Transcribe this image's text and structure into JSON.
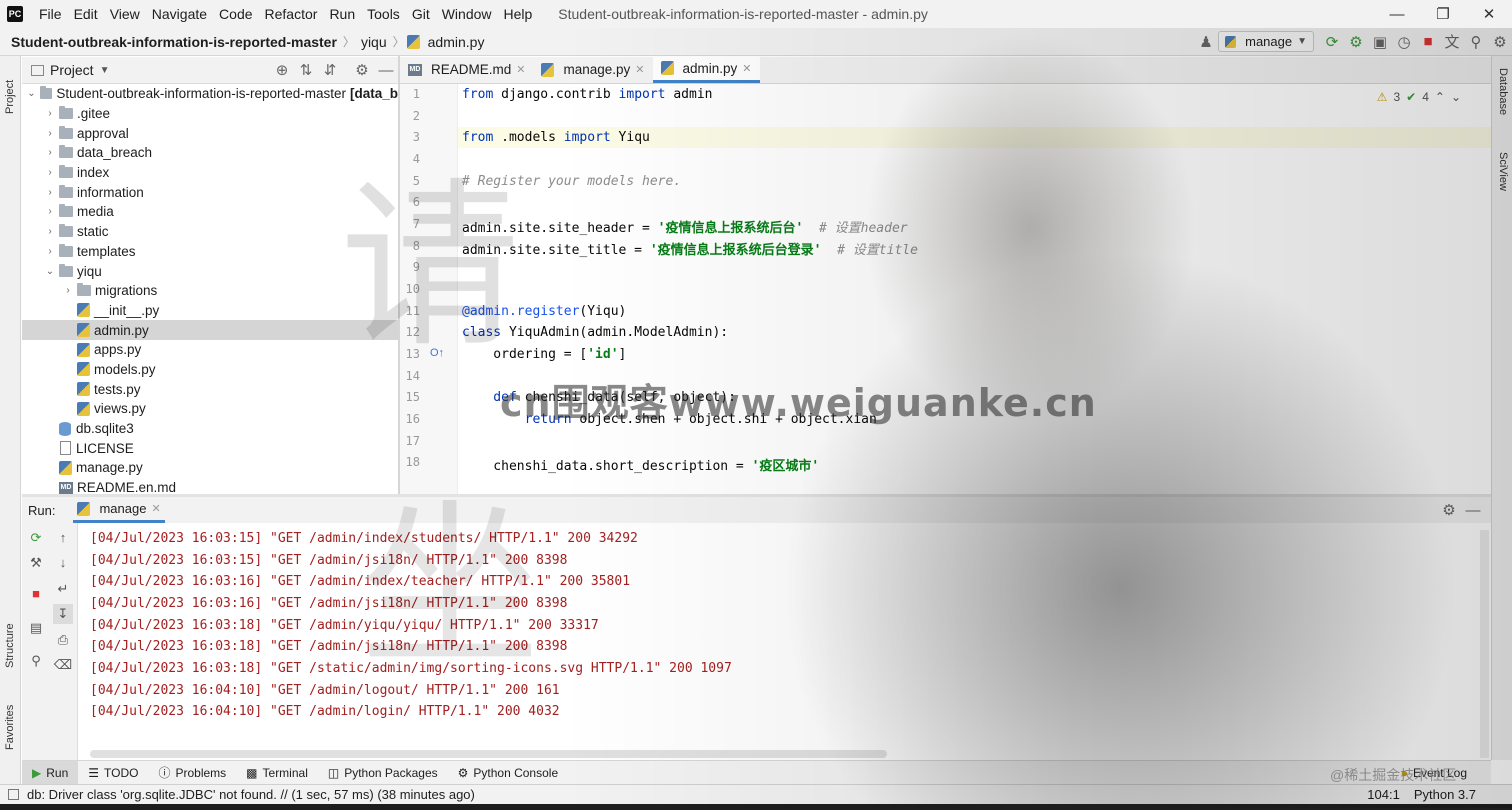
{
  "menubar": {
    "items": [
      "File",
      "Edit",
      "View",
      "Navigate",
      "Code",
      "Refactor",
      "Run",
      "Tools",
      "Git",
      "Window",
      "Help"
    ],
    "window_title": "Student-outbreak-information-is-reported-master - admin.py"
  },
  "navbar": {
    "breadcrumbs": [
      "Student-outbreak-information-is-reported-master",
      "yiqu",
      "admin.py"
    ],
    "run_config": "manage"
  },
  "left_strip": {
    "project": "Project",
    "structure": "Structure",
    "favorites": "Favorites"
  },
  "right_strip": {
    "database": "Database",
    "sciview": "SciView"
  },
  "project_panel": {
    "title": "Project",
    "root": "Student-outbreak-information-is-reported-master",
    "root_suffix": "[data_b",
    "items": [
      ".gitee",
      "approval",
      "data_breach",
      "index",
      "information",
      "media",
      "static",
      "templates",
      "yiqu",
      "migrations",
      "__init__.py",
      "admin.py",
      "apps.py",
      "models.py",
      "tests.py",
      "views.py",
      "db.sqlite3",
      "LICENSE",
      "manage.py",
      "README.en.md"
    ]
  },
  "editor": {
    "tabs": [
      "README.md",
      "manage.py",
      "admin.py"
    ],
    "line_numbers": [
      "1",
      "2",
      "3",
      "4",
      "5",
      "6",
      "7",
      "8",
      "9",
      "10",
      "11",
      "12",
      "13",
      "14",
      "15",
      "16",
      "17",
      "18"
    ],
    "inspections": {
      "warnings": "3",
      "ok": "4"
    },
    "code": {
      "l1_kw1": "from",
      "l1_mod": " django.contrib ",
      "l1_kw2": "import",
      "l1_name": " admin",
      "l3_kw1": "from",
      "l3_mod": " .models ",
      "l3_kw2": "import",
      "l3_name": " Yiqu",
      "l5_cmt": "# Register your models here.",
      "l7_code": "admin.site.site_header = ",
      "l7_str": "'疫情信息上报系统后台'",
      "l7_cmt": "  # 设置header",
      "l8_code": "admin.site.site_title = ",
      "l8_str": "'疫情信息上报系统后台登录'",
      "l8_cmt": "  # 设置title",
      "l11_deco": "@admin.register",
      "l11_rest": "(Yiqu)",
      "l12_kw": "class",
      "l12_rest": " YiquAdmin(admin.ModelAdmin):",
      "l13_code": "    ordering = [",
      "l13_str": "'id'",
      "l13_end": "]",
      "l15_kw": "    def",
      "l15_rest": " chenshi_data(self, object):",
      "l16_kw": "        return",
      "l16_rest": " object.shen + object.shi + object.xian",
      "l18_code": "    chenshi_data.short_description = ",
      "l18_str": "'疫区城市'"
    }
  },
  "run_panel": {
    "label": "Run:",
    "tab": "manage",
    "lines": [
      "[04/Jul/2023 16:03:15] \"GET /admin/index/students/ HTTP/1.1\" 200 34292",
      "[04/Jul/2023 16:03:15] \"GET /admin/jsi18n/ HTTP/1.1\" 200 8398",
      "[04/Jul/2023 16:03:16] \"GET /admin/index/teacher/ HTTP/1.1\" 200 35801",
      "[04/Jul/2023 16:03:16] \"GET /admin/jsi18n/ HTTP/1.1\" 200 8398",
      "[04/Jul/2023 16:03:18] \"GET /admin/yiqu/yiqu/ HTTP/1.1\" 200 33317",
      "[04/Jul/2023 16:03:18] \"GET /admin/jsi18n/ HTTP/1.1\" 200 8398",
      "[04/Jul/2023 16:03:18] \"GET /static/admin/img/sorting-icons.svg HTTP/1.1\" 200 1097",
      "[04/Jul/2023 16:04:10] \"GET /admin/logout/ HTTP/1.1\" 200 161",
      "[04/Jul/2023 16:04:10] \"GET /admin/login/ HTTP/1.1\" 200 4032"
    ]
  },
  "bottom_tabs": [
    "Run",
    "TODO",
    "Problems",
    "Terminal",
    "Python Packages",
    "Python Console"
  ],
  "event_log": "Event Log",
  "statusbar": {
    "message": "db: Driver class 'org.sqlite.JDBC' not found. // (1 sec, 57 ms) (38 minutes ago)",
    "position": "104:1",
    "interpreter": "Python 3.7"
  },
  "watermark": {
    "char1": "请",
    "char2": "坐",
    "site": "cn围观客www.weiguanke.cn",
    "credit": "@稀土掘金技术社区"
  }
}
